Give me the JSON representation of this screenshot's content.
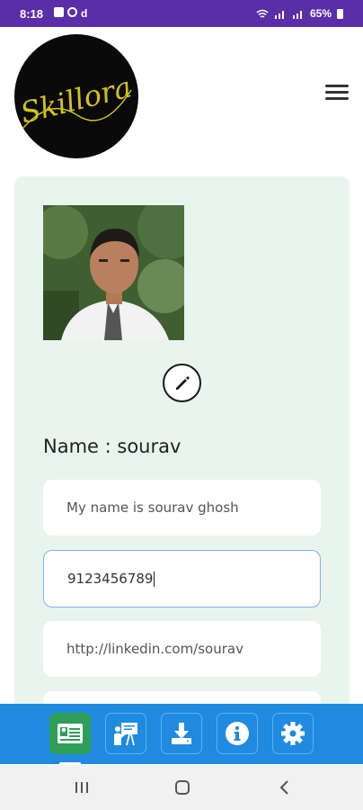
{
  "status_bar": {
    "time": "8:18",
    "carrier_letter": "d",
    "battery": "65%"
  },
  "header": {
    "logo_text": "Skillora",
    "logo_colors": {
      "background": "#0a0a0a",
      "script": "#d4c21a"
    },
    "menu_icon": "hamburger-icon"
  },
  "profile": {
    "photo_alt": "profile photo",
    "edit_icon": "pencil-icon",
    "name_line": "Name : sourav",
    "fields": {
      "about": "My name is sourav ghosh",
      "phone": "9123456789",
      "linkedin": "http://linkedin.com/sourav"
    }
  },
  "tabs": [
    {
      "icon": "id-card-icon",
      "active": true
    },
    {
      "icon": "presentation-icon",
      "active": false
    },
    {
      "icon": "download-icon",
      "active": false
    },
    {
      "icon": "info-icon",
      "active": false
    },
    {
      "icon": "gear-icon",
      "active": false
    }
  ],
  "colors": {
    "status_bar": "#5a2ea8",
    "card_background": "#e8f5ee",
    "tabbar": "#1f8ae0",
    "active_tab": "#2f9e57",
    "focused_border": "#7fb3e6"
  }
}
